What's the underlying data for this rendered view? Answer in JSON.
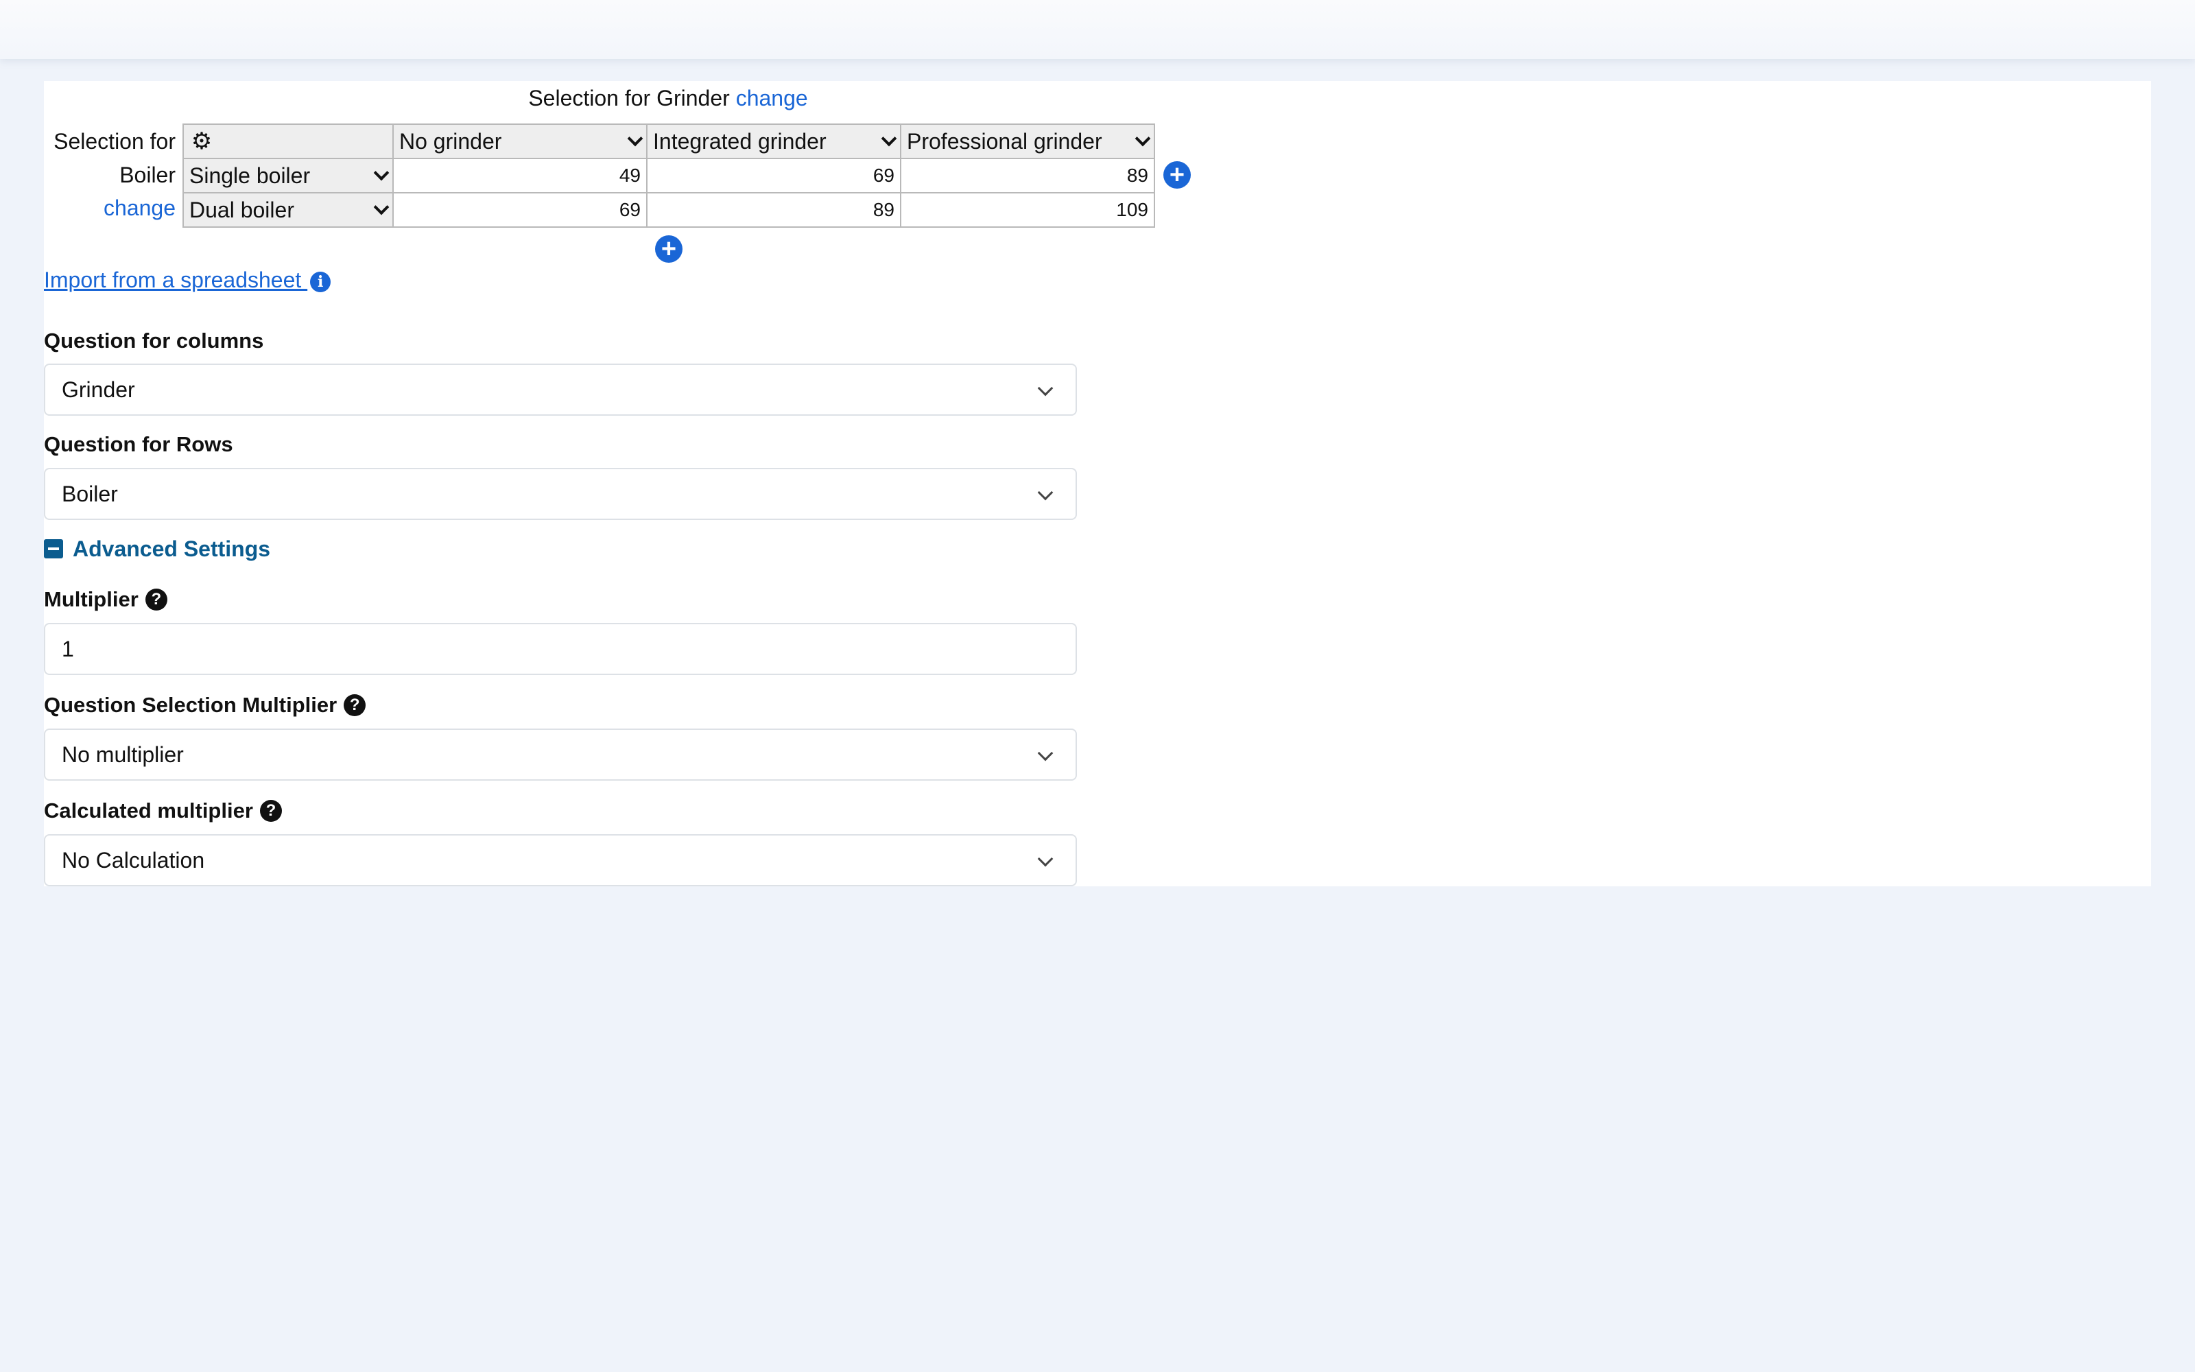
{
  "matrix": {
    "title_prefix": "Selection for Grinder",
    "title_change": "change",
    "selection_for_label": "Selection for",
    "row_question": "Boiler",
    "row_change": "change",
    "column_headers": [
      "No grinder",
      "Integrated grinder",
      "Professional grinder"
    ],
    "rows": [
      {
        "label": "Single boiler",
        "values": [
          "49",
          "69",
          "89"
        ]
      },
      {
        "label": "Dual boiler",
        "values": [
          "69",
          "89",
          "109"
        ]
      }
    ]
  },
  "import_link": "Import from a spreadsheet ",
  "fields": {
    "columns_label": "Question for columns",
    "columns_value": "Grinder",
    "rows_label": "Question for Rows",
    "rows_value": "Boiler",
    "advanced_label": "Advanced Settings",
    "multiplier_label": "Multiplier",
    "multiplier_value": "1",
    "qsm_label": "Question Selection Multiplier",
    "qsm_value": "No multiplier",
    "calc_label": "Calculated multiplier",
    "calc_value": "No Calculation"
  },
  "icons": {
    "gear": "gear-icon",
    "add": "plus-circle-icon",
    "info": "info-icon",
    "help": "question-circle-icon",
    "collapse": "minus-square-icon"
  },
  "colors": {
    "accent": "#1a66d6",
    "advanced": "#0b5c8f",
    "background": "#eff3fa"
  }
}
